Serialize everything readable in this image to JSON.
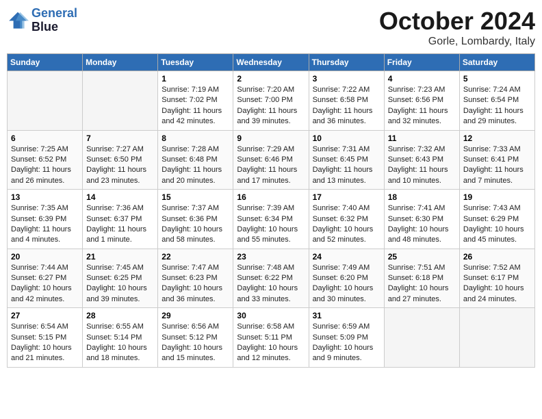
{
  "header": {
    "logo_line1": "General",
    "logo_line2": "Blue",
    "month": "October 2024",
    "location": "Gorle, Lombardy, Italy"
  },
  "weekdays": [
    "Sunday",
    "Monday",
    "Tuesday",
    "Wednesday",
    "Thursday",
    "Friday",
    "Saturday"
  ],
  "weeks": [
    [
      {
        "day": "",
        "empty": true
      },
      {
        "day": "",
        "empty": true
      },
      {
        "day": "1",
        "sunrise": "7:19 AM",
        "sunset": "7:02 PM",
        "daylight": "11 hours and 42 minutes."
      },
      {
        "day": "2",
        "sunrise": "7:20 AM",
        "sunset": "7:00 PM",
        "daylight": "11 hours and 39 minutes."
      },
      {
        "day": "3",
        "sunrise": "7:22 AM",
        "sunset": "6:58 PM",
        "daylight": "11 hours and 36 minutes."
      },
      {
        "day": "4",
        "sunrise": "7:23 AM",
        "sunset": "6:56 PM",
        "daylight": "11 hours and 32 minutes."
      },
      {
        "day": "5",
        "sunrise": "7:24 AM",
        "sunset": "6:54 PM",
        "daylight": "11 hours and 29 minutes."
      }
    ],
    [
      {
        "day": "6",
        "sunrise": "7:25 AM",
        "sunset": "6:52 PM",
        "daylight": "11 hours and 26 minutes."
      },
      {
        "day": "7",
        "sunrise": "7:27 AM",
        "sunset": "6:50 PM",
        "daylight": "11 hours and 23 minutes."
      },
      {
        "day": "8",
        "sunrise": "7:28 AM",
        "sunset": "6:48 PM",
        "daylight": "11 hours and 20 minutes."
      },
      {
        "day": "9",
        "sunrise": "7:29 AM",
        "sunset": "6:46 PM",
        "daylight": "11 hours and 17 minutes."
      },
      {
        "day": "10",
        "sunrise": "7:31 AM",
        "sunset": "6:45 PM",
        "daylight": "11 hours and 13 minutes."
      },
      {
        "day": "11",
        "sunrise": "7:32 AM",
        "sunset": "6:43 PM",
        "daylight": "11 hours and 10 minutes."
      },
      {
        "day": "12",
        "sunrise": "7:33 AM",
        "sunset": "6:41 PM",
        "daylight": "11 hours and 7 minutes."
      }
    ],
    [
      {
        "day": "13",
        "sunrise": "7:35 AM",
        "sunset": "6:39 PM",
        "daylight": "11 hours and 4 minutes."
      },
      {
        "day": "14",
        "sunrise": "7:36 AM",
        "sunset": "6:37 PM",
        "daylight": "11 hours and 1 minute."
      },
      {
        "day": "15",
        "sunrise": "7:37 AM",
        "sunset": "6:36 PM",
        "daylight": "10 hours and 58 minutes."
      },
      {
        "day": "16",
        "sunrise": "7:39 AM",
        "sunset": "6:34 PM",
        "daylight": "10 hours and 55 minutes."
      },
      {
        "day": "17",
        "sunrise": "7:40 AM",
        "sunset": "6:32 PM",
        "daylight": "10 hours and 52 minutes."
      },
      {
        "day": "18",
        "sunrise": "7:41 AM",
        "sunset": "6:30 PM",
        "daylight": "10 hours and 48 minutes."
      },
      {
        "day": "19",
        "sunrise": "7:43 AM",
        "sunset": "6:29 PM",
        "daylight": "10 hours and 45 minutes."
      }
    ],
    [
      {
        "day": "20",
        "sunrise": "7:44 AM",
        "sunset": "6:27 PM",
        "daylight": "10 hours and 42 minutes."
      },
      {
        "day": "21",
        "sunrise": "7:45 AM",
        "sunset": "6:25 PM",
        "daylight": "10 hours and 39 minutes."
      },
      {
        "day": "22",
        "sunrise": "7:47 AM",
        "sunset": "6:23 PM",
        "daylight": "10 hours and 36 minutes."
      },
      {
        "day": "23",
        "sunrise": "7:48 AM",
        "sunset": "6:22 PM",
        "daylight": "10 hours and 33 minutes."
      },
      {
        "day": "24",
        "sunrise": "7:49 AM",
        "sunset": "6:20 PM",
        "daylight": "10 hours and 30 minutes."
      },
      {
        "day": "25",
        "sunrise": "7:51 AM",
        "sunset": "6:18 PM",
        "daylight": "10 hours and 27 minutes."
      },
      {
        "day": "26",
        "sunrise": "7:52 AM",
        "sunset": "6:17 PM",
        "daylight": "10 hours and 24 minutes."
      }
    ],
    [
      {
        "day": "27",
        "sunrise": "6:54 AM",
        "sunset": "5:15 PM",
        "daylight": "10 hours and 21 minutes."
      },
      {
        "day": "28",
        "sunrise": "6:55 AM",
        "sunset": "5:14 PM",
        "daylight": "10 hours and 18 minutes."
      },
      {
        "day": "29",
        "sunrise": "6:56 AM",
        "sunset": "5:12 PM",
        "daylight": "10 hours and 15 minutes."
      },
      {
        "day": "30",
        "sunrise": "6:58 AM",
        "sunset": "5:11 PM",
        "daylight": "10 hours and 12 minutes."
      },
      {
        "day": "31",
        "sunrise": "6:59 AM",
        "sunset": "5:09 PM",
        "daylight": "10 hours and 9 minutes."
      },
      {
        "day": "",
        "empty": true
      },
      {
        "day": "",
        "empty": true
      }
    ]
  ]
}
